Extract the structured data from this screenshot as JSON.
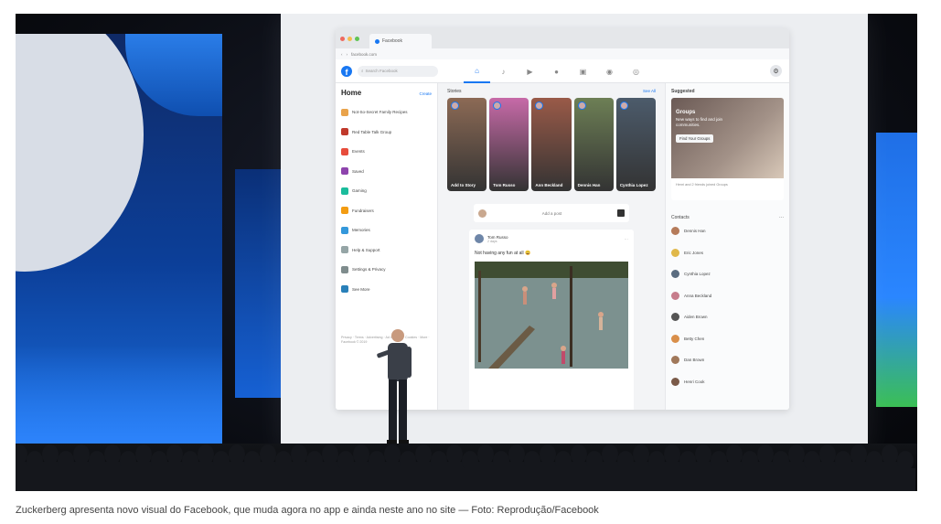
{
  "caption": "Zuckerberg apresenta novo visual do Facebook, que muda agora no app e ainda neste ano no site — Foto: Reprodução/Facebook",
  "browser": {
    "tab_title": "Facebook",
    "url": "facebook.com"
  },
  "facebook": {
    "search_placeholder": "Search Facebook",
    "nav_icons": [
      "home-icon",
      "bell-icon",
      "video-icon",
      "avatar-icon",
      "marketplace-icon",
      "groups-icon",
      "gaming-icon"
    ],
    "left": {
      "title": "Home",
      "create_label": "Create",
      "items": [
        {
          "label": "Not-So-Secret Family Recipes",
          "color": "#e9a34b"
        },
        {
          "label": "Red Table Talk Group",
          "color": "#c0392b"
        },
        {
          "label": "Events",
          "color": "#e74c3c"
        },
        {
          "label": "Saved",
          "color": "#8e44ad"
        },
        {
          "label": "Gaming",
          "color": "#1abc9c"
        },
        {
          "label": "Fundraisers",
          "color": "#f39c12"
        },
        {
          "label": "Memories",
          "color": "#3498db"
        },
        {
          "label": "Help & Support",
          "color": "#95a5a6"
        },
        {
          "label": "Settings & Privacy",
          "color": "#7f8c8d"
        },
        {
          "label": "See More",
          "color": "#2980b9"
        }
      ],
      "footer": "Privacy · Terms · Advertising · Ad Choices · Cookies · More · Facebook © 2019"
    },
    "stories": {
      "title": "Stories",
      "see_all": "See All",
      "items": [
        {
          "name": "Add to Story",
          "color": "#8c6a55"
        },
        {
          "name": "Tom Russo",
          "color": "#c76aa8"
        },
        {
          "name": "Ann Beckland",
          "color": "#9a5a48"
        },
        {
          "name": "Dennis Han",
          "color": "#6d7f55"
        },
        {
          "name": "Cynthia Lopez",
          "color": "#4c5b6b"
        }
      ]
    },
    "add_post": "Add a post",
    "post": {
      "author": "Tom Russo",
      "time": "2 days",
      "text": "Not having any fun at all 😄"
    },
    "suggested": {
      "title": "Suggested",
      "group_title": "Groups",
      "group_text": "New ways to find and join communities.",
      "group_button": "Find Your Groups",
      "footer": "Henri and 2 friends joined Groups"
    },
    "contacts": {
      "title": "Contacts",
      "items": [
        {
          "name": "Dennis Han",
          "color": "#b57b5a"
        },
        {
          "name": "Eric Jones",
          "color": "#e0b84a"
        },
        {
          "name": "Cynthia Lopez",
          "color": "#5a6c80"
        },
        {
          "name": "Anna Beckland",
          "color": "#c77d8c"
        },
        {
          "name": "Aiden Brown",
          "color": "#555555"
        },
        {
          "name": "Betty Chen",
          "color": "#d98f4a"
        },
        {
          "name": "Dan Brown",
          "color": "#a0785a"
        },
        {
          "name": "Henri Cook",
          "color": "#7a5a48"
        }
      ]
    }
  }
}
